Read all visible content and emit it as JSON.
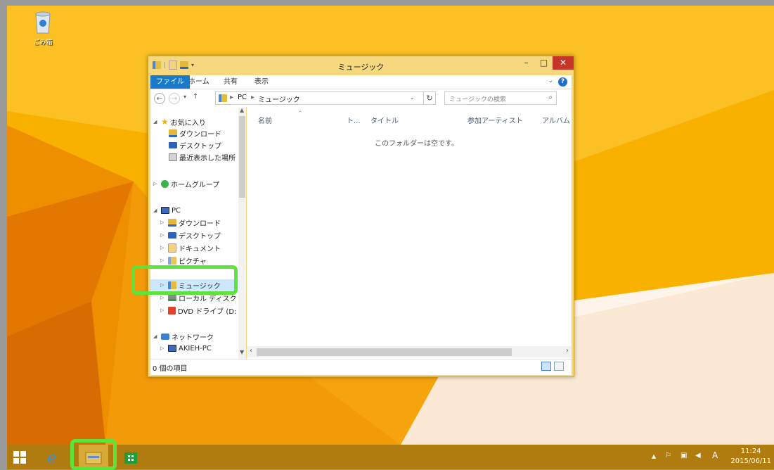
{
  "desktop": {
    "recycle_bin_label": "ごみ箱"
  },
  "window": {
    "title": "ミュージック",
    "close_label": "✕",
    "ribbon_tabs": [
      "ファイル",
      "ホーム",
      "共有",
      "表示"
    ],
    "address": {
      "crumbs": [
        "PC",
        "ミュージック"
      ]
    },
    "search_placeholder": "ミュージックの検索",
    "columns": [
      "名前",
      "ト...",
      "タイトル",
      "参加アーティスト",
      "アルバム"
    ],
    "empty_message": "このフォルダーは空です。",
    "status": "0 個の項目",
    "nav": {
      "favorites": "お気に入り",
      "fav_items": [
        "ダウンロード",
        "デスクトップ",
        "最近表示した場所"
      ],
      "homegroup": "ホームグループ",
      "pc": "PC",
      "pc_items": [
        "ダウンロード",
        "デスクトップ",
        "ドキュメント",
        "ピクチャ",
        "ミュージック",
        "ローカル ディスク (C",
        "DVD ドライブ (D:"
      ],
      "network": "ネットワーク",
      "network_items": [
        "AKIEH-PC"
      ]
    }
  },
  "taskbar": {
    "ime": "A",
    "time": "11:24",
    "date": "2015/06/11"
  },
  "colors": {
    "desktop_orange": "#f7a800",
    "title_close": "#c7352a",
    "file_tab": "#1979ca",
    "highlight": "#5ee33a",
    "taskbar": "#b07c10"
  }
}
